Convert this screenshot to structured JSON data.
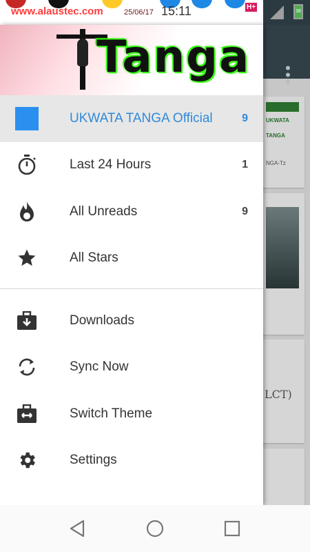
{
  "status_bar": {
    "site": "www.alaustec.com",
    "date": "25/06/17",
    "time": "15:11",
    "network": "H+",
    "battery": "38"
  },
  "header": {
    "logo_text": "Tanga"
  },
  "drawer": {
    "primary_items": [
      {
        "label": "UKWATA TANGA Official",
        "count": "9",
        "icon": "blue-square-icon",
        "active": true
      },
      {
        "label": "Last 24 Hours",
        "count": "1",
        "icon": "stopwatch-icon"
      },
      {
        "label": "All Unreads",
        "count": "9",
        "icon": "flame-icon"
      },
      {
        "label": "All Stars",
        "count": "",
        "icon": "star-icon"
      }
    ],
    "secondary_items": [
      {
        "label": "Downloads",
        "icon": "download-briefcase-icon"
      },
      {
        "label": "Sync Now",
        "icon": "sync-icon"
      },
      {
        "label": "Switch Theme",
        "icon": "switch-theme-icon"
      },
      {
        "label": "Settings",
        "icon": "gear-icon"
      }
    ]
  },
  "background": {
    "card1_title": "UKWATA",
    "card1_sub": "TANGA",
    "card1_meta": "NGA-Tz",
    "card3_text": "LCT)"
  },
  "colors": {
    "accent": "#2f8ad8",
    "active_bg": "#e7e7e7",
    "toolbar": "#37474f"
  }
}
